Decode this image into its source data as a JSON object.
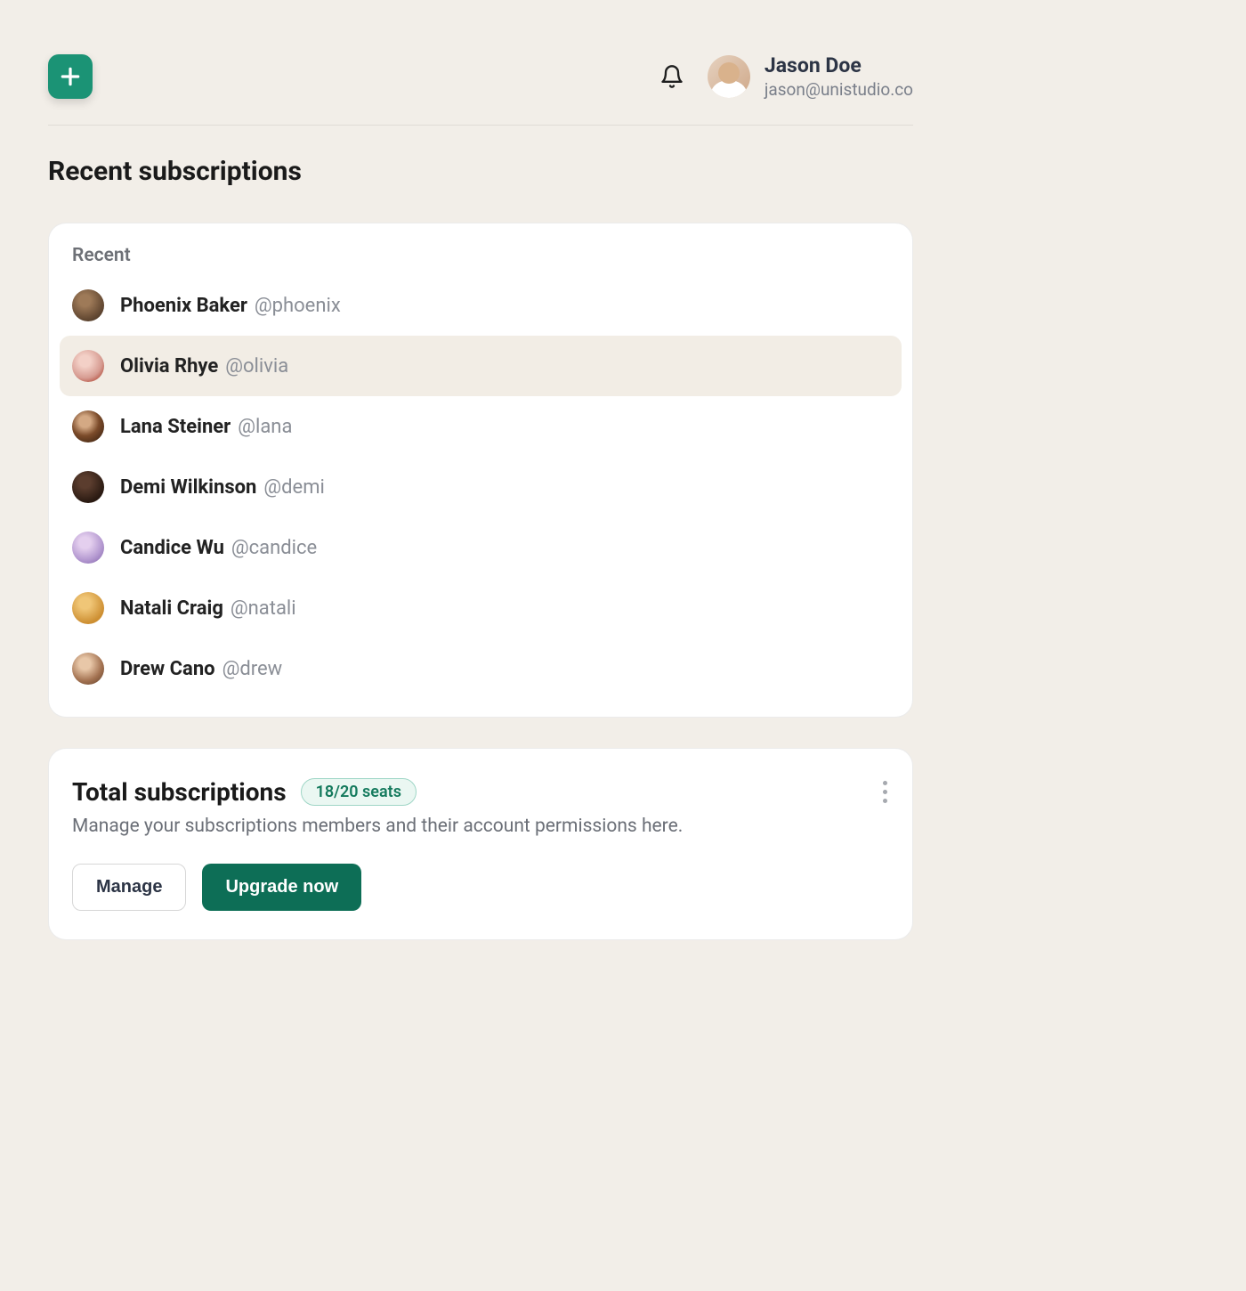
{
  "header": {
    "user_name": "Jason Doe",
    "user_email": "jason@unistudio.co"
  },
  "page_title": "Recent subscriptions",
  "recent": {
    "label": "Recent",
    "items": [
      {
        "name": "Phoenix Baker",
        "handle": "@phoenix",
        "selected": false
      },
      {
        "name": "Olivia Rhye",
        "handle": "@olivia",
        "selected": true
      },
      {
        "name": "Lana Steiner",
        "handle": "@lana",
        "selected": false
      },
      {
        "name": "Demi Wilkinson",
        "handle": "@demi",
        "selected": false
      },
      {
        "name": "Candice Wu",
        "handle": "@candice",
        "selected": false
      },
      {
        "name": "Natali Craig",
        "handle": "@natali",
        "selected": false
      },
      {
        "name": "Drew Cano",
        "handle": "@drew",
        "selected": false
      }
    ]
  },
  "total": {
    "title": "Total subscriptions",
    "badge": "18/20 seats",
    "description": "Manage your subscriptions members and their account permissions here.",
    "manage_label": "Manage",
    "upgrade_label": "Upgrade now"
  }
}
